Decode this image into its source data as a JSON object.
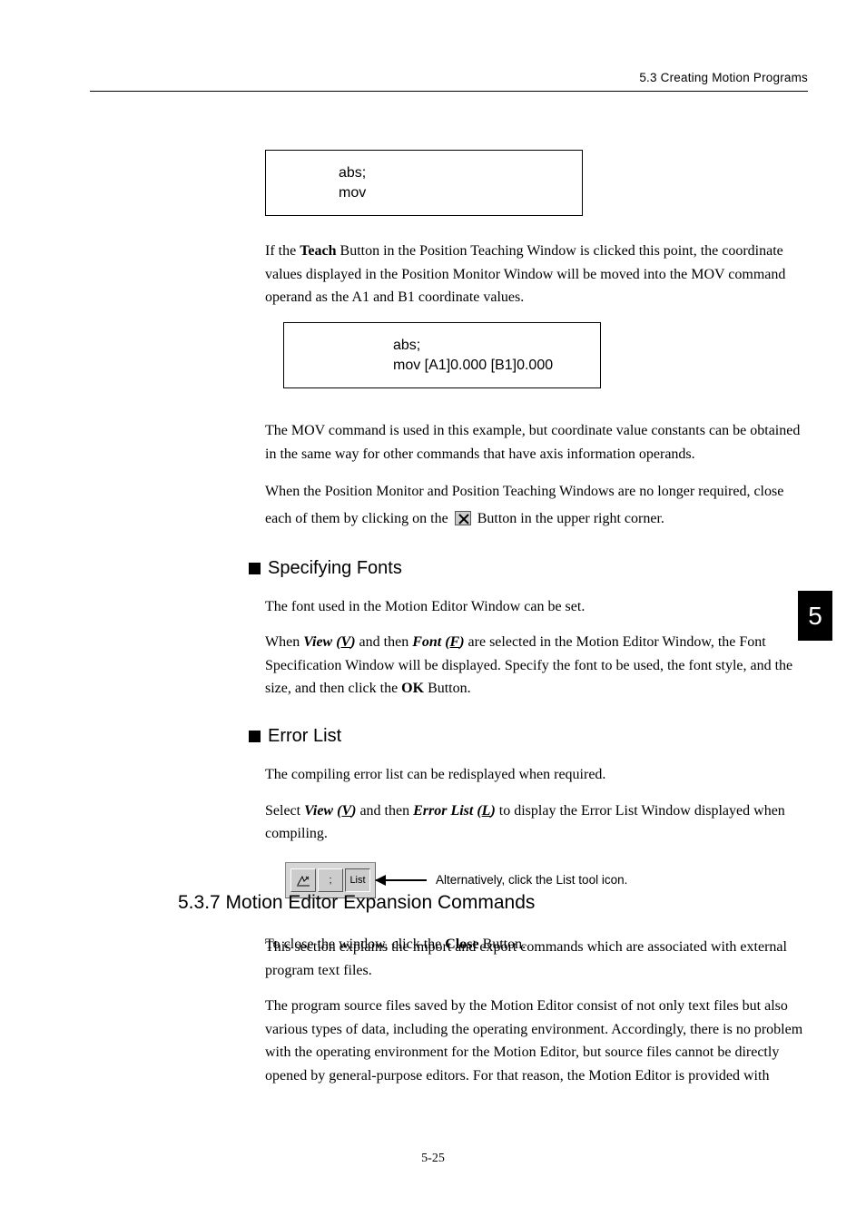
{
  "header": {
    "running_head": "5.3  Creating Motion Programs"
  },
  "code1": {
    "line1": "abs;",
    "line2": "mov"
  },
  "para_teach": {
    "pre": "If the ",
    "teach": "Teach",
    "post": " Button in the Position Teaching Window is clicked this point, the coordinate values displayed in the Position Monitor Window will be moved into the MOV command operand as the A1 and B1 coordinate values."
  },
  "code2": {
    "line1": "abs;",
    "line2": "mov  [A1]0.000 [B1]0.000"
  },
  "para_mov": "The MOV command is used in this example, but coordinate value constants can be obtained in the same way for other commands that have axis information operands.",
  "para_close": {
    "pre": "When the Position Monitor and Position Teaching Windows are no longer required, close each of them by clicking on the ",
    "post": " Button in the upper right corner."
  },
  "sec_fonts": {
    "title": "Specifying Fonts",
    "p1": "The font used in the Motion Editor Window can be set.",
    "p2_pre": "When ",
    "view": "View (",
    "view_u": "V",
    "view_close": ")",
    "mid": " and then ",
    "font": "Font (",
    "font_u": "F",
    "font_close": ")",
    "p2_post1": " are selected in the Motion Editor Window, the Font Specification Window will be displayed. Specify the font to be used, the font style, and the size, and then click the ",
    "ok": "OK",
    "p2_post2": " Button."
  },
  "sec_error": {
    "title": "Error List",
    "p1": "The compiling error list can be redisplayed when required.",
    "p2_pre": "Select ",
    "view": "View (",
    "view_u": "V",
    "view_close": ")",
    "mid": " and then ",
    "el": "Error List (",
    "el_u": "L",
    "el_close": ")",
    "p2_post": " to display the Error List Window displayed when compiling.",
    "caption": "Alternatively, click the List tool icon.",
    "list_label": "List",
    "semicolon": ";",
    "p3_pre": "To close the window, click the ",
    "close": "Close",
    "p3_post": " Button."
  },
  "h537": {
    "title": "5.3.7  Motion Editor Expansion Commands",
    "p1": "This section explains the import and export commands which are associated with external program text files.",
    "p2": "The program source files saved by the Motion Editor consist of not only text files but also various types of data, including the operating environment. Accordingly, there is no problem with the operating environment for the Motion Editor, but source files cannot be directly opened by general-purpose editors. For that reason, the Motion Editor is provided with"
  },
  "chapter_number": "5",
  "page_number": "5-25"
}
